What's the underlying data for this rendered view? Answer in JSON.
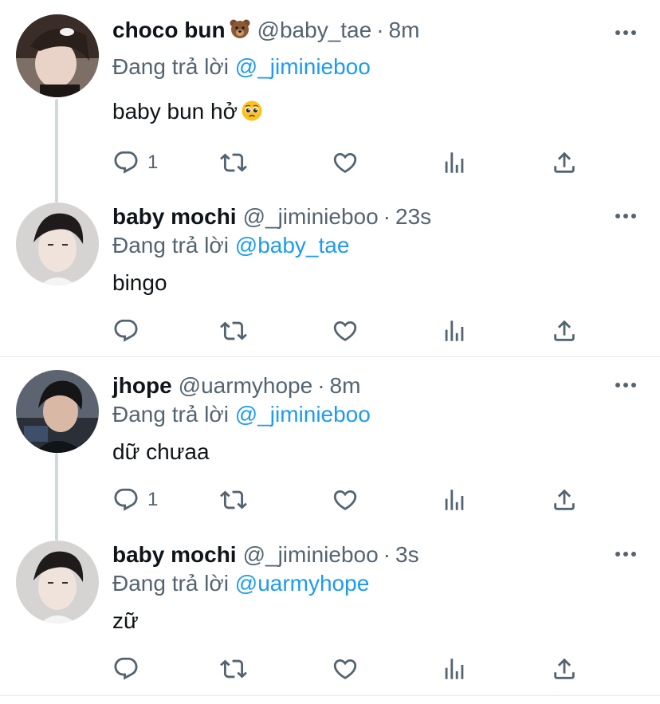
{
  "tweets": [
    {
      "name": "choco bun",
      "name_emoji": "bear",
      "handle": "@baby_tae",
      "time": "8m",
      "reply_label": "Đang trả lời",
      "reply_mention": "@_jiminieboo",
      "text": "baby bun hở",
      "text_emoji": "pleading-face",
      "reply_count": "1"
    },
    {
      "name": "baby mochi",
      "handle": "@_jiminieboo",
      "time": "23s",
      "reply_label": "Đang trả lời",
      "reply_mention": "@baby_tae",
      "text": "bingo",
      "reply_count": ""
    },
    {
      "name": "jhope",
      "handle": "@uarmyhope",
      "time": "8m",
      "reply_label": "Đang trả lời",
      "reply_mention": "@_jiminieboo",
      "text": "dữ chưaa",
      "reply_count": "1"
    },
    {
      "name": "baby mochi",
      "handle": "@_jiminieboo",
      "time": "3s",
      "reply_label": "Đang trả lời",
      "reply_mention": "@uarmyhope",
      "text": "zữ",
      "reply_count": ""
    }
  ],
  "colors": {
    "link": "#1d9bf0",
    "secondary": "#536471",
    "text": "#0f1419",
    "thread_line": "#cfd9de",
    "divider": "#e6ecf0"
  },
  "icons": [
    "reply-icon",
    "retweet-icon",
    "like-icon",
    "analytics-icon",
    "share-icon",
    "more-icon"
  ]
}
